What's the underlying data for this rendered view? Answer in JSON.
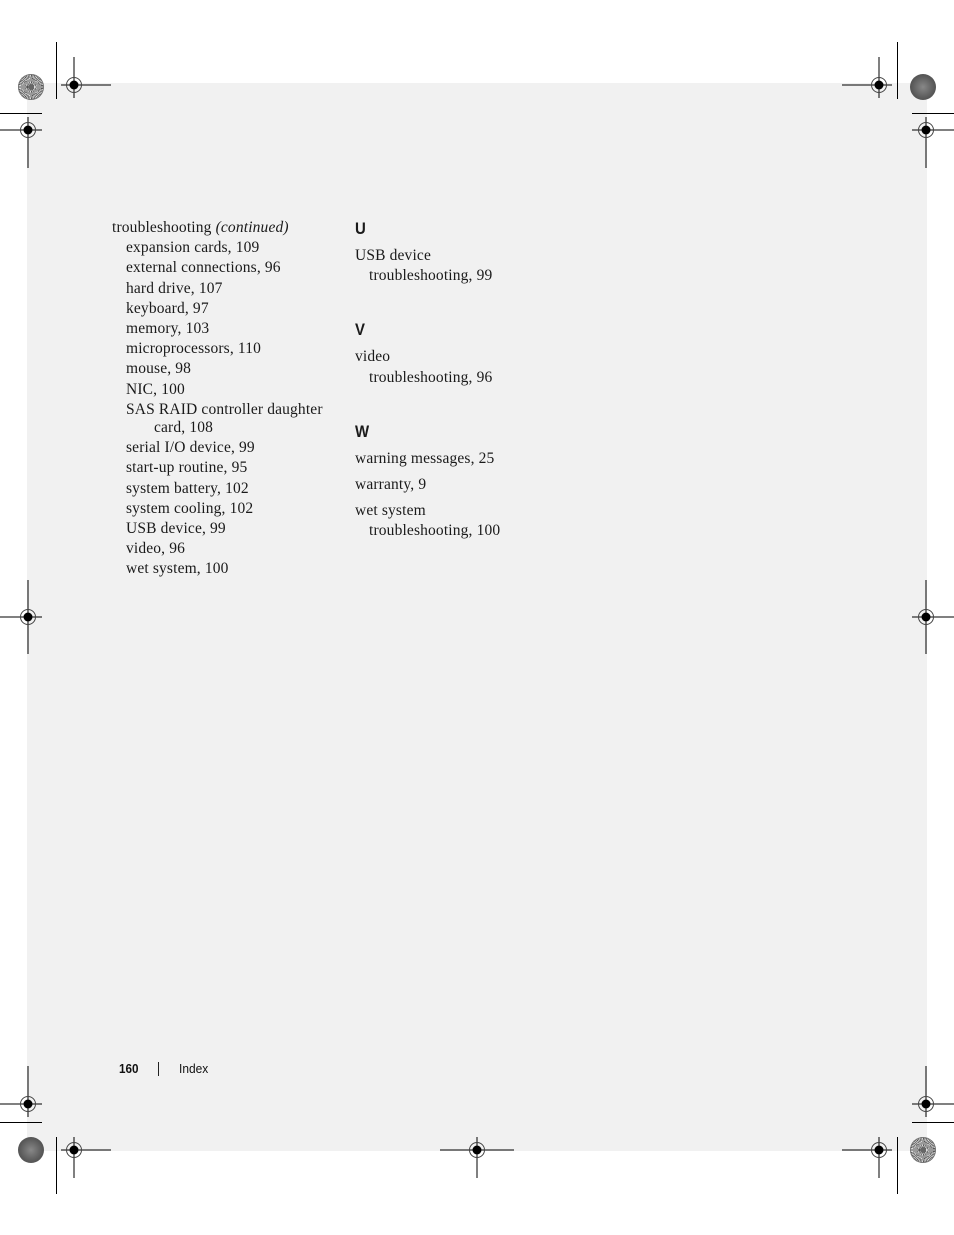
{
  "page": {
    "number": "160",
    "section_title": "Index"
  },
  "left_column": {
    "heading_term": "troubleshooting",
    "heading_suffix": "(continued)",
    "subentries": [
      {
        "text": "expansion cards, 109"
      },
      {
        "text": "external connections, 96"
      },
      {
        "text": "hard drive, 107"
      },
      {
        "text": "keyboard, 97"
      },
      {
        "text": "memory, 103"
      },
      {
        "text": "microprocessors, 110"
      },
      {
        "text": "mouse, 98"
      },
      {
        "text": "NIC, 100"
      },
      {
        "text": "SAS RAID controller daughter",
        "continuation": "card, 108"
      },
      {
        "text": "serial I/O device, 99"
      },
      {
        "text": "start-up routine, 95"
      },
      {
        "text": "system battery, 102"
      },
      {
        "text": "system cooling, 102"
      },
      {
        "text": "USB device, 99"
      },
      {
        "text": "video, 96"
      },
      {
        "text": "wet system, 100"
      }
    ]
  },
  "right_column": {
    "sections": [
      {
        "letter": "U",
        "entries": [
          {
            "term": "USB device",
            "sub": "troubleshooting, 99"
          }
        ]
      },
      {
        "letter": "V",
        "entries": [
          {
            "term": "video",
            "sub": "troubleshooting, 96"
          }
        ]
      },
      {
        "letter": "W",
        "entries": [
          {
            "term": "warning messages, 25"
          },
          {
            "term": "warranty, 9"
          },
          {
            "term": "wet system",
            "sub": "troubleshooting, 100"
          }
        ]
      }
    ]
  },
  "print_marks": {
    "registration_mark_icon": "crosshair-target",
    "color_bar_icon": "gradient-rosette"
  }
}
